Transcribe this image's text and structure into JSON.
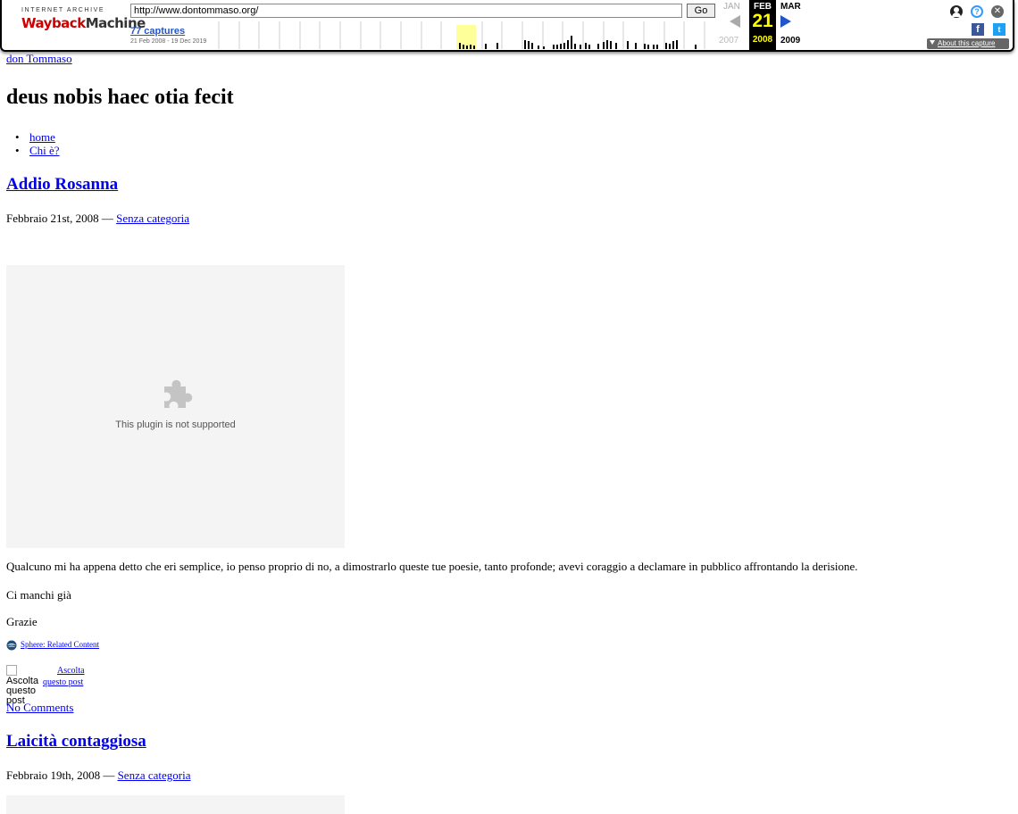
{
  "wayback": {
    "logo_top": "INTERNET ARCHIVE",
    "logo_wayback": "Wayback",
    "logo_machine": "Machine",
    "url": "http://www.dontommaso.org/",
    "go_label": "Go",
    "captures_label": "77 captures",
    "date_range": "21 Feb 2008 - 19 Dec 2019",
    "prev_month": "JAN",
    "current_month": "FEB",
    "next_month": "MAR",
    "current_day": "21",
    "prev_year": "2007",
    "current_year": "2008",
    "next_year": "2009",
    "about_label": "About this capture",
    "help_glyph": "?",
    "close_glyph": "✕",
    "fb_glyph": "f",
    "tw_glyph": "t",
    "icons": [
      "user-icon",
      "help-icon",
      "close-icon",
      "facebook-icon",
      "twitter-icon"
    ],
    "colors": {
      "accent": "#2255cc",
      "highlight": "#ffff00",
      "logo_red": "#cc0000"
    }
  },
  "page": {
    "site_link": "don Tommaso",
    "site_title": "deus nobis haec otia fecit",
    "nav": [
      {
        "label": "home"
      },
      {
        "label": "Chi è?"
      }
    ],
    "posts": [
      {
        "title": "Addio Rosanna",
        "date": "Febbraio 21st, 2008",
        "sep": " — ",
        "category": "Senza categoria",
        "plugin_message": "This plugin is not supported",
        "paragraphs": [
          "Qualcuno mi ha appena detto che eri semplice, io penso proprio di no, a dimostrarlo queste tue poesie, tanto profonde;  avevi coraggio a declamare in pubblico affrontando la derisione.",
          "Ci manchi già",
          "Grazie"
        ],
        "sphere_link": "Sphere: Related Content",
        "listen_alt": "Ascolta questo post",
        "listen_link_1": "Ascolta",
        "listen_link_2": "questo post",
        "comments_link": "No Comments"
      },
      {
        "title": "Laicità contaggiosa",
        "date": "Febbraio 19th, 2008",
        "sep": " — ",
        "category": "Senza categoria"
      }
    ]
  }
}
